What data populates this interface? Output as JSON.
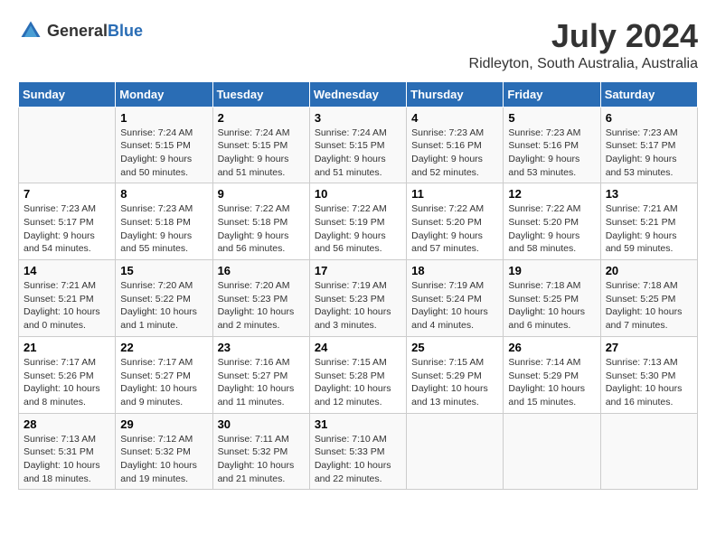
{
  "logo": {
    "general": "General",
    "blue": "Blue"
  },
  "title": "July 2024",
  "subtitle": "Ridleyton, South Australia, Australia",
  "days_of_week": [
    "Sunday",
    "Monday",
    "Tuesday",
    "Wednesday",
    "Thursday",
    "Friday",
    "Saturday"
  ],
  "weeks": [
    [
      {
        "day": "",
        "info": ""
      },
      {
        "day": "1",
        "info": "Sunrise: 7:24 AM\nSunset: 5:15 PM\nDaylight: 9 hours\nand 50 minutes."
      },
      {
        "day": "2",
        "info": "Sunrise: 7:24 AM\nSunset: 5:15 PM\nDaylight: 9 hours\nand 51 minutes."
      },
      {
        "day": "3",
        "info": "Sunrise: 7:24 AM\nSunset: 5:15 PM\nDaylight: 9 hours\nand 51 minutes."
      },
      {
        "day": "4",
        "info": "Sunrise: 7:23 AM\nSunset: 5:16 PM\nDaylight: 9 hours\nand 52 minutes."
      },
      {
        "day": "5",
        "info": "Sunrise: 7:23 AM\nSunset: 5:16 PM\nDaylight: 9 hours\nand 53 minutes."
      },
      {
        "day": "6",
        "info": "Sunrise: 7:23 AM\nSunset: 5:17 PM\nDaylight: 9 hours\nand 53 minutes."
      }
    ],
    [
      {
        "day": "7",
        "info": "Sunrise: 7:23 AM\nSunset: 5:17 PM\nDaylight: 9 hours\nand 54 minutes."
      },
      {
        "day": "8",
        "info": "Sunrise: 7:23 AM\nSunset: 5:18 PM\nDaylight: 9 hours\nand 55 minutes."
      },
      {
        "day": "9",
        "info": "Sunrise: 7:22 AM\nSunset: 5:18 PM\nDaylight: 9 hours\nand 56 minutes."
      },
      {
        "day": "10",
        "info": "Sunrise: 7:22 AM\nSunset: 5:19 PM\nDaylight: 9 hours\nand 56 minutes."
      },
      {
        "day": "11",
        "info": "Sunrise: 7:22 AM\nSunset: 5:20 PM\nDaylight: 9 hours\nand 57 minutes."
      },
      {
        "day": "12",
        "info": "Sunrise: 7:22 AM\nSunset: 5:20 PM\nDaylight: 9 hours\nand 58 minutes."
      },
      {
        "day": "13",
        "info": "Sunrise: 7:21 AM\nSunset: 5:21 PM\nDaylight: 9 hours\nand 59 minutes."
      }
    ],
    [
      {
        "day": "14",
        "info": "Sunrise: 7:21 AM\nSunset: 5:21 PM\nDaylight: 10 hours\nand 0 minutes."
      },
      {
        "day": "15",
        "info": "Sunrise: 7:20 AM\nSunset: 5:22 PM\nDaylight: 10 hours\nand 1 minute."
      },
      {
        "day": "16",
        "info": "Sunrise: 7:20 AM\nSunset: 5:23 PM\nDaylight: 10 hours\nand 2 minutes."
      },
      {
        "day": "17",
        "info": "Sunrise: 7:19 AM\nSunset: 5:23 PM\nDaylight: 10 hours\nand 3 minutes."
      },
      {
        "day": "18",
        "info": "Sunrise: 7:19 AM\nSunset: 5:24 PM\nDaylight: 10 hours\nand 4 minutes."
      },
      {
        "day": "19",
        "info": "Sunrise: 7:18 AM\nSunset: 5:25 PM\nDaylight: 10 hours\nand 6 minutes."
      },
      {
        "day": "20",
        "info": "Sunrise: 7:18 AM\nSunset: 5:25 PM\nDaylight: 10 hours\nand 7 minutes."
      }
    ],
    [
      {
        "day": "21",
        "info": "Sunrise: 7:17 AM\nSunset: 5:26 PM\nDaylight: 10 hours\nand 8 minutes."
      },
      {
        "day": "22",
        "info": "Sunrise: 7:17 AM\nSunset: 5:27 PM\nDaylight: 10 hours\nand 9 minutes."
      },
      {
        "day": "23",
        "info": "Sunrise: 7:16 AM\nSunset: 5:27 PM\nDaylight: 10 hours\nand 11 minutes."
      },
      {
        "day": "24",
        "info": "Sunrise: 7:15 AM\nSunset: 5:28 PM\nDaylight: 10 hours\nand 12 minutes."
      },
      {
        "day": "25",
        "info": "Sunrise: 7:15 AM\nSunset: 5:29 PM\nDaylight: 10 hours\nand 13 minutes."
      },
      {
        "day": "26",
        "info": "Sunrise: 7:14 AM\nSunset: 5:29 PM\nDaylight: 10 hours\nand 15 minutes."
      },
      {
        "day": "27",
        "info": "Sunrise: 7:13 AM\nSunset: 5:30 PM\nDaylight: 10 hours\nand 16 minutes."
      }
    ],
    [
      {
        "day": "28",
        "info": "Sunrise: 7:13 AM\nSunset: 5:31 PM\nDaylight: 10 hours\nand 18 minutes."
      },
      {
        "day": "29",
        "info": "Sunrise: 7:12 AM\nSunset: 5:32 PM\nDaylight: 10 hours\nand 19 minutes."
      },
      {
        "day": "30",
        "info": "Sunrise: 7:11 AM\nSunset: 5:32 PM\nDaylight: 10 hours\nand 21 minutes."
      },
      {
        "day": "31",
        "info": "Sunrise: 7:10 AM\nSunset: 5:33 PM\nDaylight: 10 hours\nand 22 minutes."
      },
      {
        "day": "",
        "info": ""
      },
      {
        "day": "",
        "info": ""
      },
      {
        "day": "",
        "info": ""
      }
    ]
  ]
}
